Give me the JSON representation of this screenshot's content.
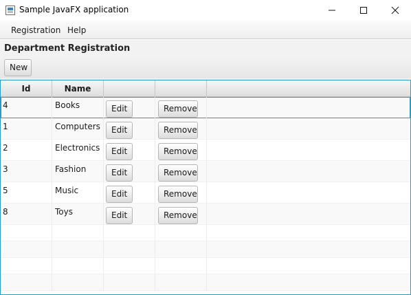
{
  "window": {
    "title": "Sample JavaFX application",
    "icons": {
      "app": "javafx-app-icon",
      "minimize": "minimize-icon",
      "maximize": "maximize-icon",
      "close": "close-icon"
    }
  },
  "menu": {
    "items": [
      {
        "label": "Registration"
      },
      {
        "label": "Help"
      }
    ]
  },
  "page": {
    "title": "Department Registration"
  },
  "toolbar": {
    "new_label": "New"
  },
  "table": {
    "columns": [
      {
        "label": "Id"
      },
      {
        "label": "Name"
      },
      {
        "label": ""
      },
      {
        "label": ""
      }
    ],
    "rows": [
      {
        "id": "4",
        "name": "Books",
        "edit": "Edit",
        "remove": "Remove",
        "selected": true
      },
      {
        "id": "1",
        "name": "Computers",
        "edit": "Edit",
        "remove": "Remove",
        "selected": false
      },
      {
        "id": "2",
        "name": "Electronics",
        "edit": "Edit",
        "remove": "Remove",
        "selected": false
      },
      {
        "id": "3",
        "name": "Fashion",
        "edit": "Edit",
        "remove": "Remove",
        "selected": false
      },
      {
        "id": "5",
        "name": "Music",
        "edit": "Edit",
        "remove": "Remove",
        "selected": false
      },
      {
        "id": "8",
        "name": "Toys",
        "edit": "Edit",
        "remove": "Remove",
        "selected": false
      }
    ]
  },
  "colors": {
    "focus_border": "#2c9ac7",
    "row_alt": "#f9f9f9",
    "header_bg": "#dedede"
  }
}
